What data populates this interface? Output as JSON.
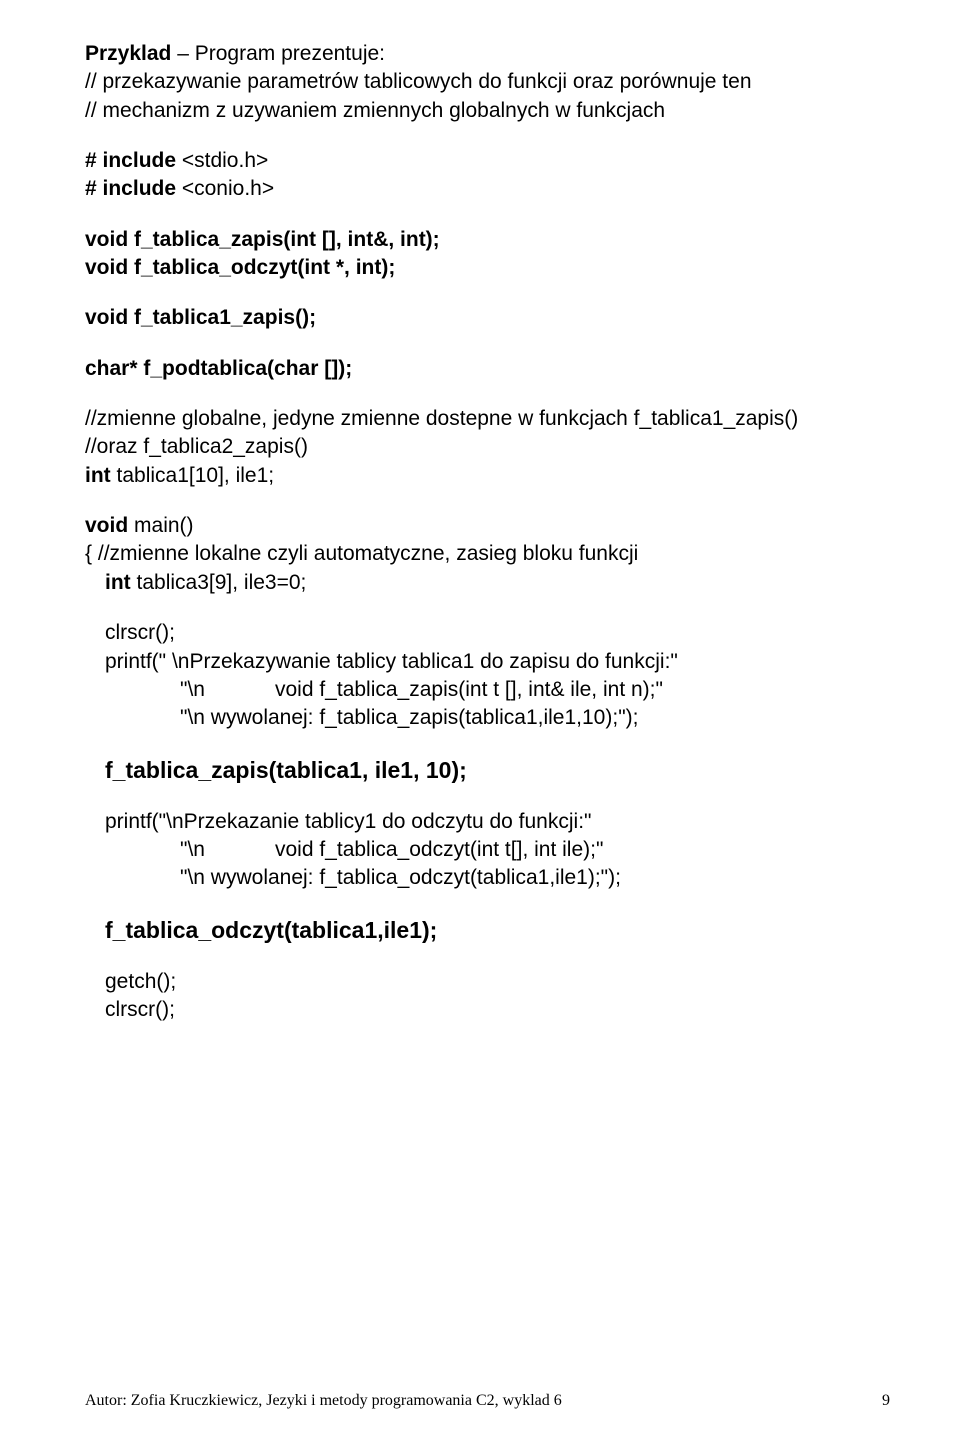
{
  "l01a": "Przyklad",
  "l01b": " – Program prezentuje:",
  "l02": "// przekazywanie parametrów tablicowych do funkcji oraz porównuje ten",
  "l03": "// mechanizm z uzywaniem zmiennych globalnych w funkcjach",
  "l04a": "# include ",
  "l04b": "<stdio.h>",
  "l05a": "# include ",
  "l05b": "<conio.h>",
  "l06": "void f_tablica_zapis(int [], int&, int);",
  "l07": "void f_tablica_odczyt(int *, int);",
  "l08": "void f_tablica1_zapis();",
  "l09": "char* f_podtablica(char []);",
  "l10": "//zmienne globalne, jedyne zmienne dostepne w funkcjach f_tablica1_zapis()",
  "l11": "//oraz f_tablica2_zapis()",
  "l12a": "int ",
  "l12b": "tablica1[10], ile1;",
  "l13a": "void ",
  "l13b": "main()",
  "l14a": "{ ",
  "l14b": "//zmienne lokalne czyli automatyczne, zasieg bloku funkcji",
  "l15a": "int ",
  "l15b": "tablica3[9], ile3=0;",
  "l16": "clrscr();",
  "l17": "printf(\" \\nPrzekazywanie tablicy tablica1 do zapisu do funkcji:\"",
  "l18": "\"\\n            void f_tablica_zapis(int t [], int& ile, int n);\"",
  "l19": "\"\\n wywolanej: f_tablica_zapis(tablica1,ile1,10);\");",
  "l20": "f_tablica_zapis(tablica1, ile1, 10);",
  "l21": "printf(\"\\nPrzekazanie tablicy1 do odczytu do funkcji:\"",
  "l22": "\"\\n            void f_tablica_odczyt(int t[], int ile);\"",
  "l23": "\"\\n wywolanej: f_tablica_odczyt(tablica1,ile1);\");",
  "l24": "f_tablica_odczyt(tablica1,ile1);",
  "l25": "getch();",
  "l26": "clrscr();",
  "footer_left": "Autor: Zofia Kruczkiewicz, Jezyki i metody programowania C2, wyklad 6",
  "footer_right": "9"
}
